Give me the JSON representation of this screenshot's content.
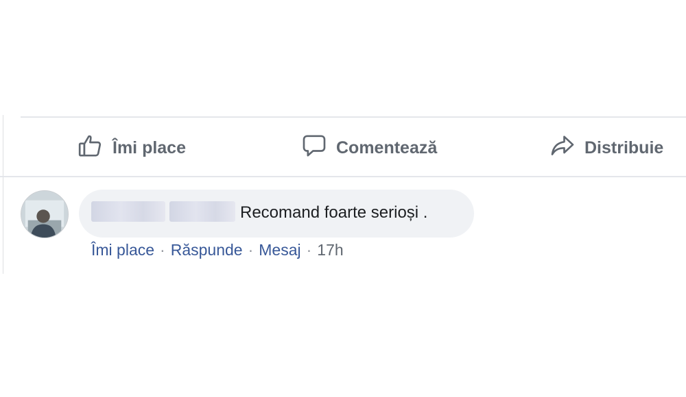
{
  "actions": {
    "like_label": "Îmi place",
    "comment_label": "Comentează",
    "share_label": "Distribuie",
    "icons": [
      "thumbs-up-icon",
      "speech-bubble-icon",
      "share-arrow-icon"
    ]
  },
  "comment": {
    "text": "Recomand foarte serioși .",
    "author_name_redacted": true,
    "actions": {
      "like_label": "Îmi place",
      "reply_label": "Răspunde",
      "message_label": "Mesaj",
      "separator": "·",
      "timestamp": "17h"
    }
  },
  "colors": {
    "action_text": "#606770",
    "link": "#385898",
    "bubble_bg": "#f0f2f5",
    "divider": "#e4e6eb"
  }
}
